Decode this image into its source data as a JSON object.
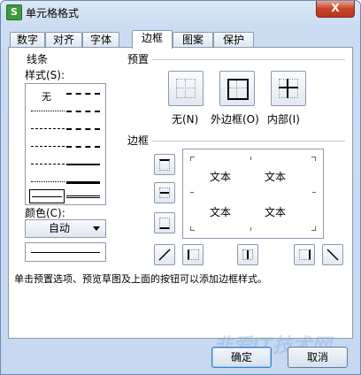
{
  "window": {
    "title": "单元格格式",
    "close_label": "X",
    "app_icon": "spreadsheet-icon",
    "app_icon_glyph": "S"
  },
  "tabs": [
    {
      "label": "数字"
    },
    {
      "label": "对齐"
    },
    {
      "label": "字体"
    },
    {
      "label": "边框",
      "active": true
    },
    {
      "label": "图案"
    },
    {
      "label": "保护"
    }
  ],
  "line": {
    "group_label": "线条",
    "style_label": "样式(S):",
    "none_label": "无",
    "color_label": "颜色(C):",
    "color_value": "自动"
  },
  "preset": {
    "group_label": "预置",
    "none_label": "无(N)",
    "outline_label": "外边框(O)",
    "inside_label": "内部(I)"
  },
  "border": {
    "group_label": "边框",
    "preview_text": [
      "文本",
      "文本",
      "文本",
      "文本"
    ]
  },
  "description": "单击预置选项、预览草图及上面的按钮可以添加边框样式。",
  "buttons": {
    "ok": "确定",
    "cancel": "取消"
  },
  "watermark": "非爱IT技术网",
  "colors": {
    "accent": "#3d7ec8",
    "title_bar": "#c9dcf2",
    "close": "#c7432a"
  }
}
